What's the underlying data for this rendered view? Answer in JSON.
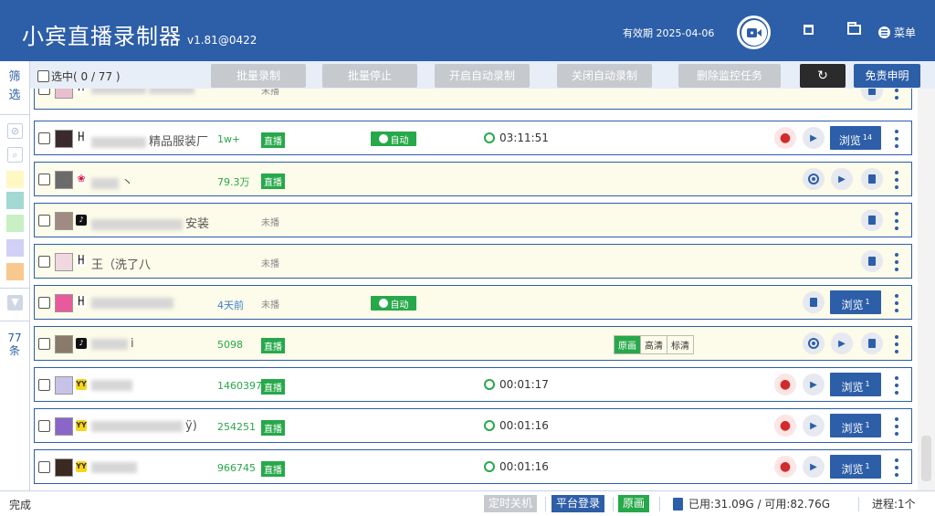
{
  "header": {
    "title": "小宾直播录制器",
    "version": "v1.81@0422",
    "expiry": "有效期 2025-04-06",
    "menu_label": "菜单"
  },
  "sidebar": {
    "filter_label": "筛选",
    "count_label": "77条",
    "swatch_colors": [
      "#fff8c4",
      "#a4d8d2",
      "#c9f0c4",
      "#d2d0f5",
      "#f8c98e"
    ]
  },
  "toolbar": {
    "select_all": "选中( 0  /  77 )",
    "buttons": [
      "批量录制",
      "批量停止",
      "开启自动录制",
      "关闭自动录制",
      "删除监控任务"
    ],
    "refresh_glyph": "↻",
    "disclaimer": "免责申明"
  },
  "rows": [
    {
      "platform": "ks",
      "platform_glyph": "ꀿ",
      "name": "精品服装厂",
      "viewers": "1w+",
      "status": "直播",
      "auto": "自动",
      "timer": "03:11:51",
      "browse": "浏览",
      "browse_count": "14"
    },
    {
      "platform": "hy",
      "platform_glyph": "❀",
      "name": "丶",
      "viewers": "79.3万",
      "status": "直播"
    },
    {
      "platform": "dy",
      "platform_glyph": "♪",
      "name": "安装",
      "viewers": "",
      "status": "未播"
    },
    {
      "platform": "ks",
      "platform_glyph": "ꀿ",
      "name": "王（洗了八",
      "viewers": "",
      "status": "未播"
    },
    {
      "platform": "ks",
      "platform_glyph": "ꀿ",
      "name": "",
      "viewers": "4天前",
      "status": "未播",
      "auto": "自动",
      "browse": "浏览",
      "browse_count": "1"
    },
    {
      "platform": "dy",
      "platform_glyph": "♪",
      "name": "i",
      "viewers": "5098",
      "status": "直播",
      "qualities": [
        "原画",
        "高清",
        "标清"
      ]
    },
    {
      "platform": "yy",
      "platform_glyph": "YY",
      "name": "",
      "viewers": "1460397",
      "status": "直播",
      "timer": "00:01:17",
      "browse": "浏览",
      "browse_count": "1"
    },
    {
      "platform": "yy",
      "platform_glyph": "YY",
      "name": "ÿ)",
      "viewers": "254251",
      "status": "直播",
      "timer": "00:01:16",
      "browse": "浏览",
      "browse_count": "1"
    },
    {
      "platform": "yy",
      "platform_glyph": "YY",
      "name": "",
      "viewers": "966745",
      "status": "直播",
      "timer": "00:01:16",
      "browse": "浏览",
      "browse_count": "1"
    }
  ],
  "partial_top_row": {
    "platform_glyph": "ꀿ",
    "status": "未播"
  },
  "statusbar": {
    "text": "完成",
    "shutdown": "定时关机",
    "login": "平台登录",
    "quality": "原画",
    "disk": "已用:31.09G / 可用:82.76G",
    "progress": "进程:1个"
  }
}
